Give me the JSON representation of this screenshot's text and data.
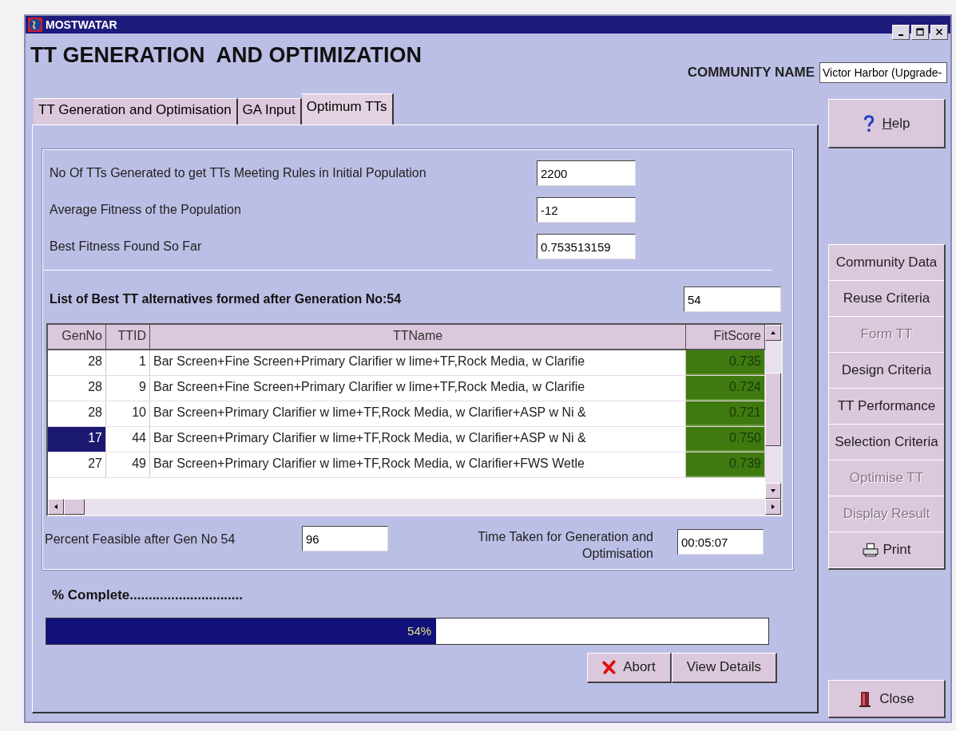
{
  "window": {
    "title": "MOSTWATAR"
  },
  "header": {
    "title": "TT GENERATION  AND OPTIMIZATION",
    "community_label": "COMMUNITY NAME",
    "community_value": "Victor Harbor (Upgrade-"
  },
  "tabs": [
    {
      "label": "TT Generation and Optimisation",
      "selected": false
    },
    {
      "label": "GA Input",
      "selected": false
    },
    {
      "label": "Optimum TTs",
      "selected": true
    }
  ],
  "stats": [
    {
      "label": "No Of TTs Generated to get TTs Meeting Rules in Initial Population",
      "value": "2200"
    },
    {
      "label": "Average Fitness of the Population",
      "value": "-12"
    },
    {
      "label": "Best Fitness Found So Far",
      "value": "0.753513159"
    }
  ],
  "list": {
    "title": "List of Best TT alternatives formed after Generation No:54",
    "value": "54"
  },
  "table": {
    "columns": [
      "GenNo",
      "TTID",
      "TTName",
      "FitScore"
    ],
    "rows": [
      {
        "cells": [
          "28",
          "1",
          "Bar Screen+Fine Screen+Primary Clarifier w lime+TF,Rock Media, w Clarifie",
          "0.735"
        ],
        "selected": false
      },
      {
        "cells": [
          "28",
          "9",
          "Bar Screen+Fine Screen+Primary Clarifier w lime+TF,Rock Media, w Clarifie",
          "0.724"
        ],
        "selected": false
      },
      {
        "cells": [
          "28",
          "10",
          "Bar Screen+Primary Clarifier w lime+TF,Rock Media, w Clarifier+ASP w Ni &",
          "0.721"
        ],
        "selected": false
      },
      {
        "cells": [
          "17",
          "44",
          "Bar Screen+Primary Clarifier w lime+TF,Rock Media, w Clarifier+ASP w Ni &",
          "0.750"
        ],
        "selected": true
      },
      {
        "cells": [
          "27",
          "49",
          "Bar Screen+Primary Clarifier w lime+TF,Rock Media, w Clarifier+FWS Wetle",
          "0.739"
        ],
        "selected": false
      }
    ]
  },
  "feasible": {
    "label": "Percent Feasible after Gen No  54",
    "value": "96"
  },
  "time": {
    "label": "Time Taken for Generation and Optimisation",
    "value": "00:05:07"
  },
  "progress": {
    "label": "% Complete..............................",
    "level": 0.54,
    "reading": "54%"
  },
  "actions": [
    {
      "label": "Abort",
      "kind": "abort"
    },
    {
      "label": "View Details",
      "kind": "plain"
    }
  ],
  "sidebar": {
    "help": "Help",
    "items": [
      {
        "label": "Community Data",
        "disabled": false,
        "kind": "text"
      },
      {
        "label": "Reuse Criteria",
        "disabled": false,
        "kind": "text"
      },
      {
        "label": "Form TT",
        "disabled": true,
        "kind": "text"
      },
      {
        "label": "Design Criteria",
        "disabled": false,
        "kind": "text"
      },
      {
        "label": "TT Performance",
        "disabled": false,
        "kind": "text"
      },
      {
        "label": "Selection Criteria",
        "disabled": false,
        "kind": "text"
      },
      {
        "label": "Optimise TT",
        "disabled": true,
        "kind": "text"
      },
      {
        "label": "Display Result",
        "disabled": true,
        "kind": "text"
      },
      {
        "label": "Print",
        "disabled": false,
        "kind": "print"
      }
    ],
    "close": "Close"
  }
}
